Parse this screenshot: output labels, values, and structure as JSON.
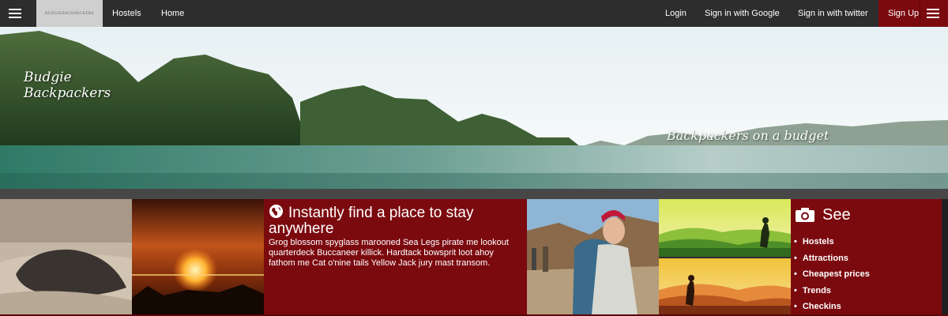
{
  "nav": {
    "menu_icon": "hamburger-icon",
    "logo_text": "BUDGIEBACKPACKERS",
    "links": [
      "Hostels",
      "Home"
    ],
    "right_links": [
      "Login",
      "Sign in with Google",
      "Sign in with twitter"
    ],
    "signup_label": "Sign Up"
  },
  "hero": {
    "title": "Budgie Backpackers",
    "tagline": "Backpackers on a budget"
  },
  "info": {
    "icon": "globe-icon",
    "title": "Instantly find a place to stay anywhere",
    "text": "Grog blossom spyglass marooned Sea Legs pirate me lookout quarterdeck Buccaneer killick. Hardtack bowsprit loot ahoy fathom me Cat o'nine tails Yellow Jack jury mast transom."
  },
  "see": {
    "icon": "camera-icon",
    "title": "See",
    "items": [
      "Hostels",
      "Attractions",
      "Cheapest prices",
      "Trends",
      "Checkins"
    ]
  },
  "colors": {
    "accent": "#7b0a0f",
    "navbar": "#2d2d2d"
  }
}
